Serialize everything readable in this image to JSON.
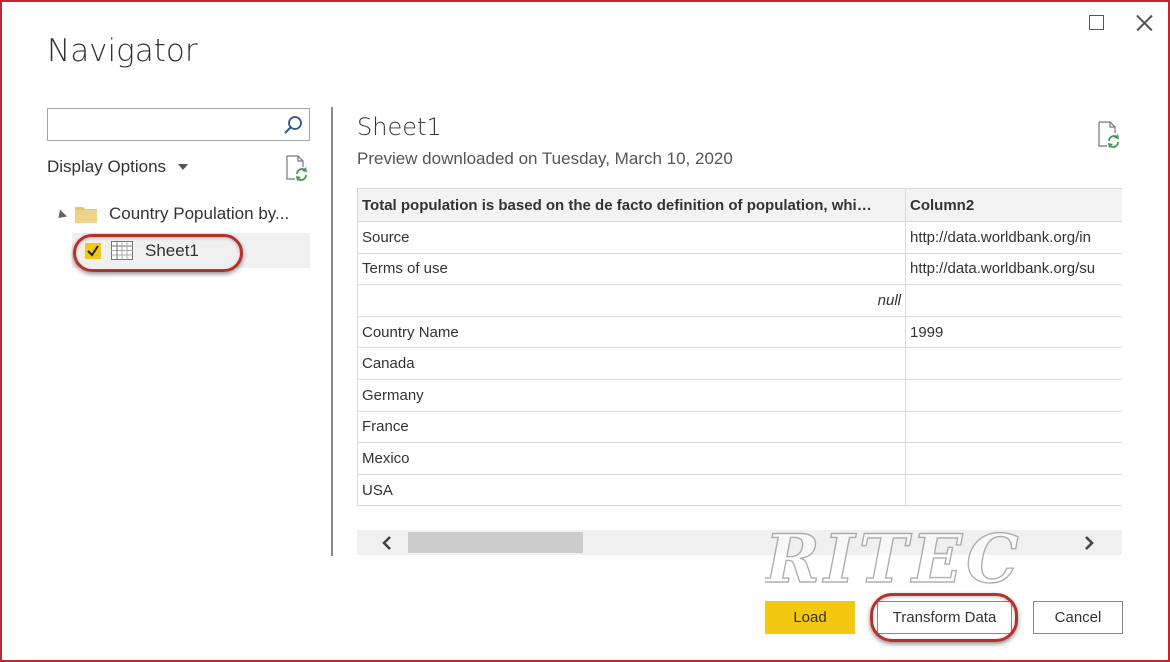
{
  "window": {
    "title": "Navigator",
    "maximize_icon": "maximize-icon",
    "close_icon": "close-icon"
  },
  "left_pane": {
    "search": {
      "value": "",
      "placeholder": "",
      "icon": "search-icon"
    },
    "display_options_label": "Display Options",
    "refresh_icon": "refresh-icon",
    "tree": {
      "folder": {
        "label": "Country Population by...",
        "icon": "folder-icon",
        "expanded": true
      },
      "items": [
        {
          "label": "Sheet1",
          "checked": true,
          "icon": "table-icon",
          "selected": true
        }
      ]
    }
  },
  "preview": {
    "title": "Sheet1",
    "subtitle": "Preview downloaded on Tuesday, March 10, 2020",
    "refresh_icon": "refresh-icon",
    "columns": [
      "Total population is based on the de facto definition of population, whi…",
      "Column2"
    ],
    "rows": [
      [
        "Source",
        "http://data.worldbank.org/in"
      ],
      [
        "Terms of use",
        "http://data.worldbank.org/su"
      ],
      [
        "null",
        ""
      ],
      [
        "Country Name",
        "1999"
      ],
      [
        "Canada",
        ""
      ],
      [
        "Germany",
        ""
      ],
      [
        "France",
        ""
      ],
      [
        "Mexico",
        ""
      ],
      [
        "USA",
        ""
      ]
    ]
  },
  "watermark": "RITEC",
  "buttons": {
    "load": "Load",
    "transform": "Transform Data",
    "cancel": "Cancel"
  },
  "colors": {
    "accent_yellow": "#f2c811",
    "frame_red": "#c0282d",
    "highlight_red": "#b5312b"
  }
}
